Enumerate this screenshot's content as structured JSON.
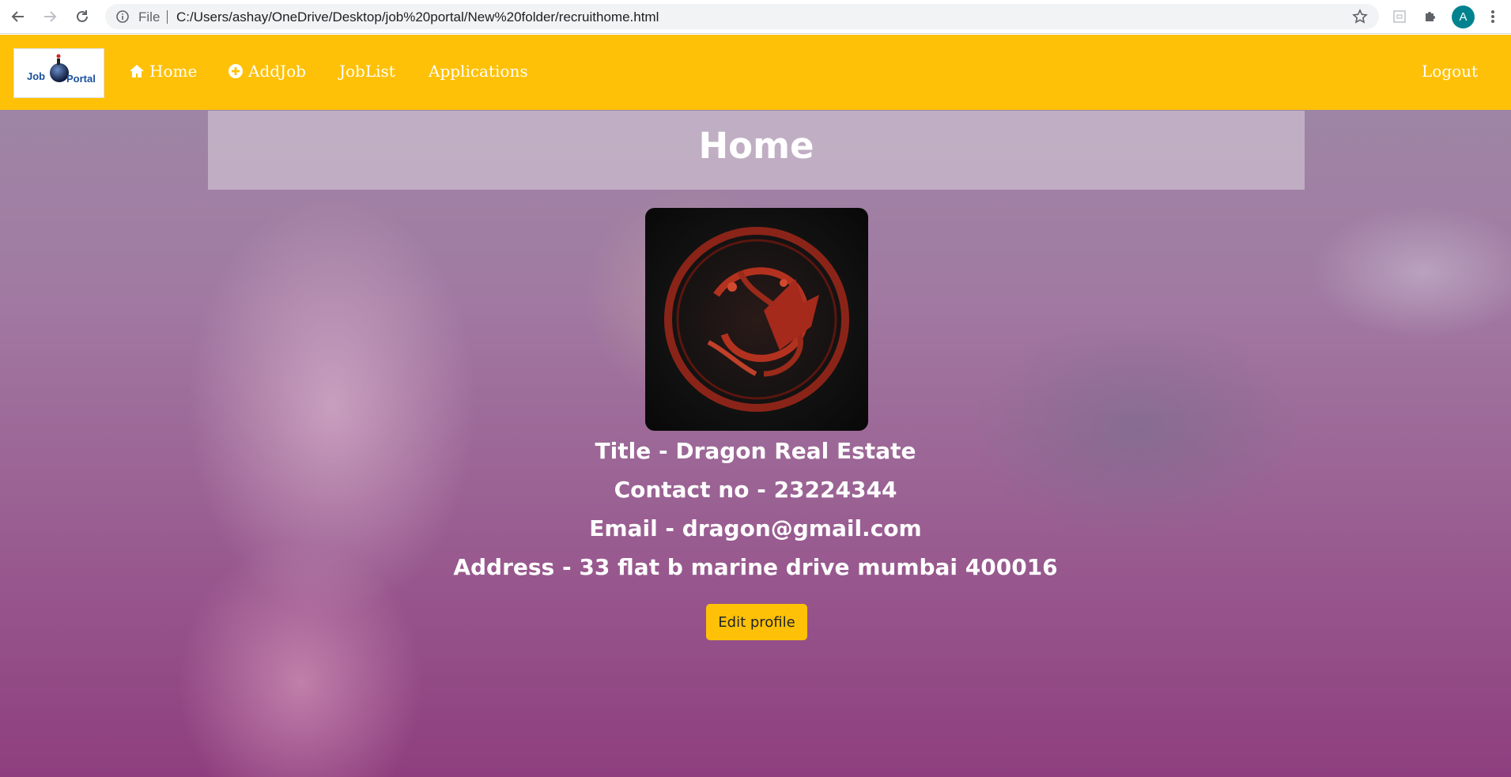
{
  "browser": {
    "file_label": "File",
    "url": "C:/Users/ashay/OneDrive/Desktop/job%20portal/New%20folder/recruithome.html",
    "profile_initial": "A"
  },
  "navbar": {
    "logo_text_left": "Job",
    "logo_text_right": "Portal",
    "links": [
      "Home",
      "AddJob",
      "JobList",
      "Applications"
    ],
    "logout": "Logout",
    "color": "#ffc107"
  },
  "hero": {
    "title": "Home"
  },
  "profile": {
    "image_icon": "dragon-sigil-image",
    "title_line": "Title - Dragon Real Estate",
    "contact_line": "Contact no - 23224344",
    "email_line": "Email - dragon@gmail.com",
    "address_line": "Address - 33 flat b marine drive mumbai 400016",
    "edit_button": "Edit profile"
  }
}
